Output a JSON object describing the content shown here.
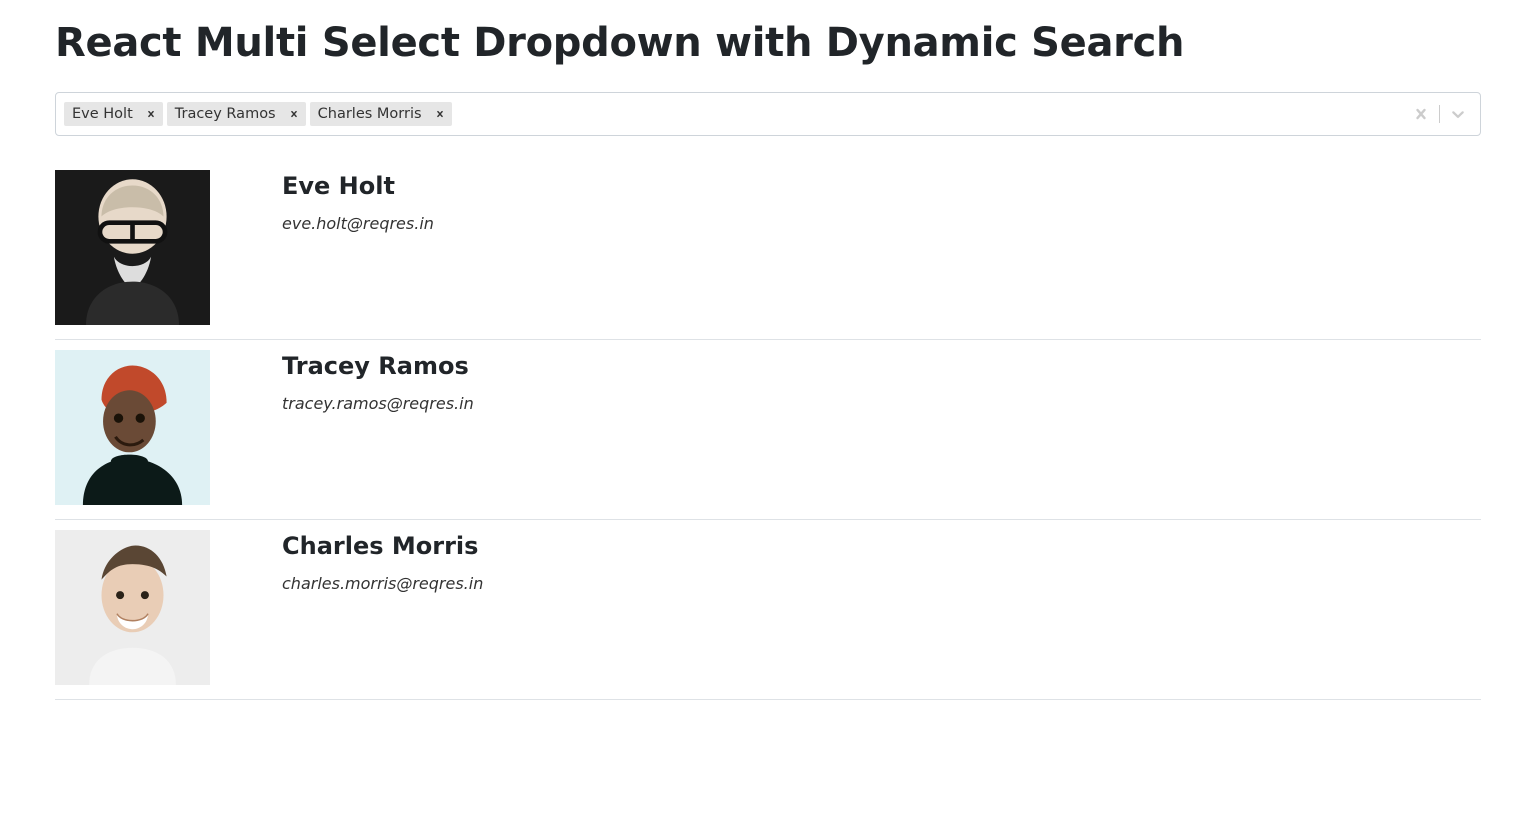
{
  "page_title": "React Multi Select Dropdown with Dynamic Search",
  "select": {
    "tags": [
      {
        "label": "Eve Holt"
      },
      {
        "label": "Tracey Ramos"
      },
      {
        "label": "Charles Morris"
      }
    ]
  },
  "selected_users": [
    {
      "name": "Eve Holt",
      "email": "eve.holt@reqres.in"
    },
    {
      "name": "Tracey Ramos",
      "email": "tracey.ramos@reqres.in"
    },
    {
      "name": "Charles Morris",
      "email": "charles.morris@reqres.in"
    }
  ]
}
